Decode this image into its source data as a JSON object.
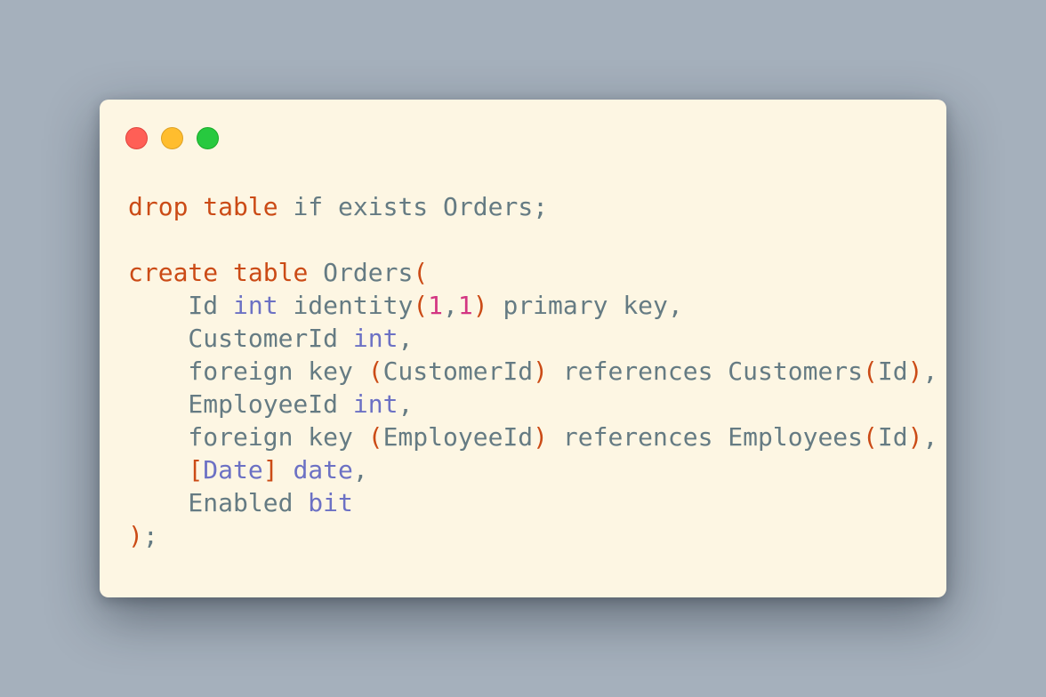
{
  "colors": {
    "background": "#a5b0bc",
    "window": "#fdf6e3",
    "keyword": "#cb4b16",
    "type": "#6c71c4",
    "number": "#d33682",
    "punct": "#cb4b16",
    "plain": "#657b83"
  },
  "window_controls": [
    {
      "name": "close-button",
      "color": "red"
    },
    {
      "name": "minimize-button",
      "color": "yellow"
    },
    {
      "name": "maximize-button",
      "color": "green"
    }
  ],
  "code": {
    "language": "sql",
    "lines": [
      [
        {
          "t": "drop",
          "k": "keyword"
        },
        {
          "t": " ",
          "k": "plain"
        },
        {
          "t": "table",
          "k": "keyword"
        },
        {
          "t": " if exists Orders;",
          "k": "plain"
        }
      ],
      [],
      [
        {
          "t": "create",
          "k": "keyword"
        },
        {
          "t": " ",
          "k": "plain"
        },
        {
          "t": "table",
          "k": "keyword"
        },
        {
          "t": " Orders",
          "k": "plain"
        },
        {
          "t": "(",
          "k": "punct"
        }
      ],
      [
        {
          "t": "    Id ",
          "k": "plain"
        },
        {
          "t": "int",
          "k": "type"
        },
        {
          "t": " identity",
          "k": "plain"
        },
        {
          "t": "(",
          "k": "punct"
        },
        {
          "t": "1",
          "k": "number"
        },
        {
          "t": ",",
          "k": "plain"
        },
        {
          "t": "1",
          "k": "number"
        },
        {
          "t": ")",
          "k": "punct"
        },
        {
          "t": " primary key,",
          "k": "plain"
        }
      ],
      [
        {
          "t": "    CustomerId ",
          "k": "plain"
        },
        {
          "t": "int",
          "k": "type"
        },
        {
          "t": ",",
          "k": "plain"
        }
      ],
      [
        {
          "t": "    foreign key ",
          "k": "plain"
        },
        {
          "t": "(",
          "k": "punct"
        },
        {
          "t": "CustomerId",
          "k": "plain"
        },
        {
          "t": ")",
          "k": "punct"
        },
        {
          "t": " references Customers",
          "k": "plain"
        },
        {
          "t": "(",
          "k": "punct"
        },
        {
          "t": "Id",
          "k": "plain"
        },
        {
          "t": ")",
          "k": "punct"
        },
        {
          "t": ",",
          "k": "plain"
        }
      ],
      [
        {
          "t": "    EmployeeId ",
          "k": "plain"
        },
        {
          "t": "int",
          "k": "type"
        },
        {
          "t": ",",
          "k": "plain"
        }
      ],
      [
        {
          "t": "    foreign key ",
          "k": "plain"
        },
        {
          "t": "(",
          "k": "punct"
        },
        {
          "t": "EmployeeId",
          "k": "plain"
        },
        {
          "t": ")",
          "k": "punct"
        },
        {
          "t": " references Employees",
          "k": "plain"
        },
        {
          "t": "(",
          "k": "punct"
        },
        {
          "t": "Id",
          "k": "plain"
        },
        {
          "t": ")",
          "k": "punct"
        },
        {
          "t": ",",
          "k": "plain"
        }
      ],
      [
        {
          "t": "    ",
          "k": "plain"
        },
        {
          "t": "[",
          "k": "punct"
        },
        {
          "t": "Date",
          "k": "type"
        },
        {
          "t": "]",
          "k": "punct"
        },
        {
          "t": " ",
          "k": "plain"
        },
        {
          "t": "date",
          "k": "type"
        },
        {
          "t": ",",
          "k": "plain"
        }
      ],
      [
        {
          "t": "    Enabled ",
          "k": "plain"
        },
        {
          "t": "bit",
          "k": "type"
        }
      ],
      [
        {
          "t": ")",
          "k": "punct"
        },
        {
          "t": ";",
          "k": "plain"
        }
      ]
    ]
  }
}
